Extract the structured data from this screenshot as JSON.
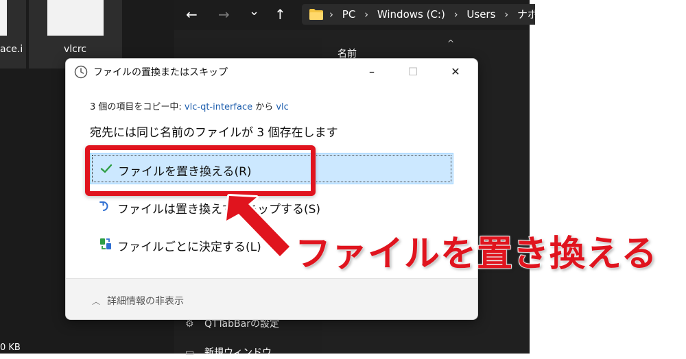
{
  "explorer_bg": {
    "file_tiles": [
      {
        "label": "ace.i"
      },
      {
        "label": "vlcrc"
      }
    ],
    "status_size": "0 KB",
    "nav": {
      "back": "←",
      "forward": "→",
      "dropdown": "⌄",
      "up": "↑"
    },
    "breadcrumb": [
      "PC",
      "Windows (C:)",
      "Users",
      "ナポ"
    ],
    "breadcrumb_sep": "›",
    "column_name": "名前",
    "menu_items": [
      "QTTabBarの設定",
      "新規ウィンドウ"
    ]
  },
  "dialog": {
    "title": "ファイルの置換またはスキップ",
    "minimize": "–",
    "maximize": "☐",
    "close": "✕",
    "copy_prefix": "3 個の項目をコピー中: ",
    "copy_source": "vlc-qt-interface",
    "copy_mid": " から ",
    "copy_dest": "vlc",
    "exists_message": "宛先には同じ名前のファイルが 3 個存在します",
    "options": {
      "replace": "ファイルを置き換える(R)",
      "skip": "ファイルは置き換えずスキップする(S)",
      "decide": "ファイルごとに決定する(L)"
    },
    "details_toggle": "詳細情報の非表示",
    "details_chevron": "︿"
  },
  "annotation": {
    "callout": "ファイルを置き換える",
    "color": "#e0141e"
  },
  "colors": {
    "selected_bg": "#cce8ff",
    "link": "#1f5fae",
    "check": "#2e9e44",
    "skip_icon": "#2f6fd1"
  }
}
